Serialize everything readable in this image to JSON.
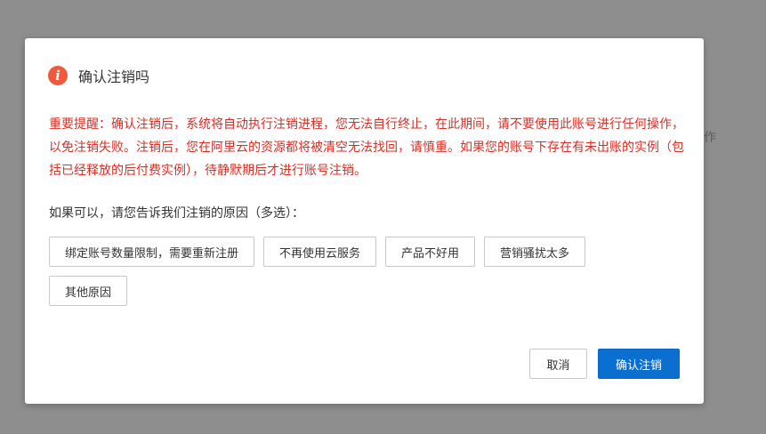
{
  "background": {
    "partial_text": "作"
  },
  "dialog": {
    "icon": "warning-info-icon",
    "title": "确认注销吗",
    "notice": "重要提醒：确认注销后，系统将自动执行注销进程，您无法自行终止，在此期间，请不要使用此账号进行任何操作，以免注销失败。注销后，您在阿里云的资源都将被清空无法找回，请慎重。如果您的账号下存在有未出账的实例（包括已经释放的后付费实例），待静默期后才进行账号注销。",
    "question": "如果可以，请您告诉我们注销的原因（多选）：",
    "options": [
      "绑定账号数量限制，需要重新注册",
      "不再使用云服务",
      "产品不好用",
      "营销骚扰太多",
      "其他原因"
    ],
    "cancel_label": "取消",
    "confirm_label": "确认注销"
  },
  "colors": {
    "warning": "#d93026",
    "icon": "#f05a3a",
    "primary": "#0b6fd0"
  }
}
